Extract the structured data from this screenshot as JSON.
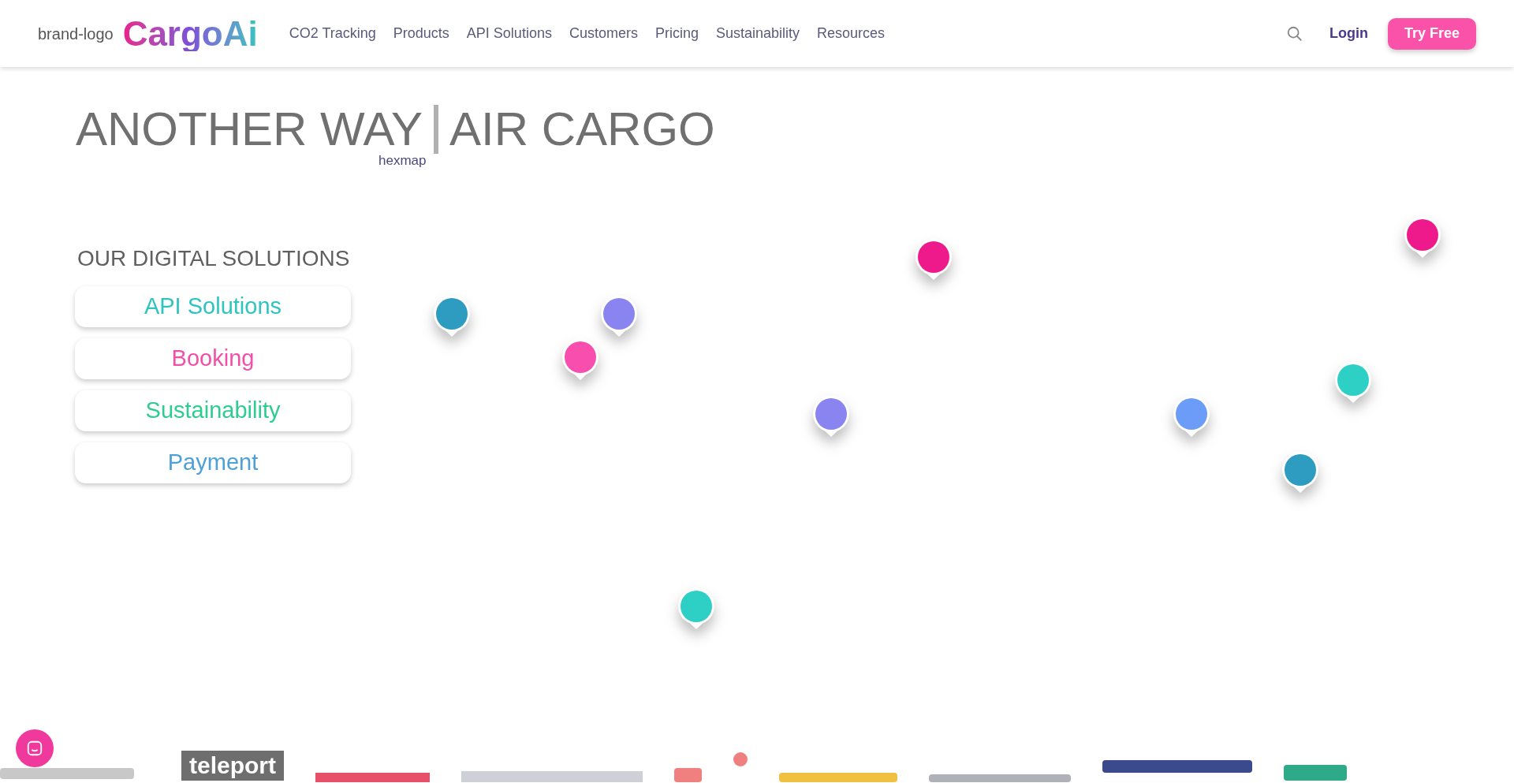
{
  "header": {
    "logo_alt": "brand-logo",
    "brand": "CargoAi",
    "nav": [
      "CO2 Tracking",
      "Products",
      "API Solutions",
      "Customers",
      "Pricing",
      "Sustainability",
      "Resources"
    ],
    "login": "Login",
    "cta": "Try Free"
  },
  "hero": {
    "title_left": "ANOTHER WAY",
    "title_right": "AIR CARGO",
    "image_alt": "hexmap"
  },
  "solutions": {
    "heading": "OUR DIGITAL SOLUTIONS",
    "items": [
      {
        "label": "API Solutions",
        "color": "#2ec4c0"
      },
      {
        "label": "Booking",
        "color": "#f050a8"
      },
      {
        "label": "Sustainability",
        "color": "#2ecc8f"
      },
      {
        "label": "Payment",
        "color": "#4ea0d8"
      }
    ]
  },
  "map_pins": [
    {
      "color": "#2e9bc0"
    },
    {
      "color": "#8a84f0"
    },
    {
      "color": "#f84fae"
    },
    {
      "color": "#ee1a8c"
    },
    {
      "color": "#ee1a8c"
    },
    {
      "color": "#8a84f0"
    },
    {
      "color": "#6b9cf7"
    },
    {
      "color": "#2ecfc4"
    },
    {
      "color": "#2e9bc0"
    },
    {
      "color": "#2ecfc4"
    }
  ],
  "partners": {
    "text_logo": "teleport"
  }
}
